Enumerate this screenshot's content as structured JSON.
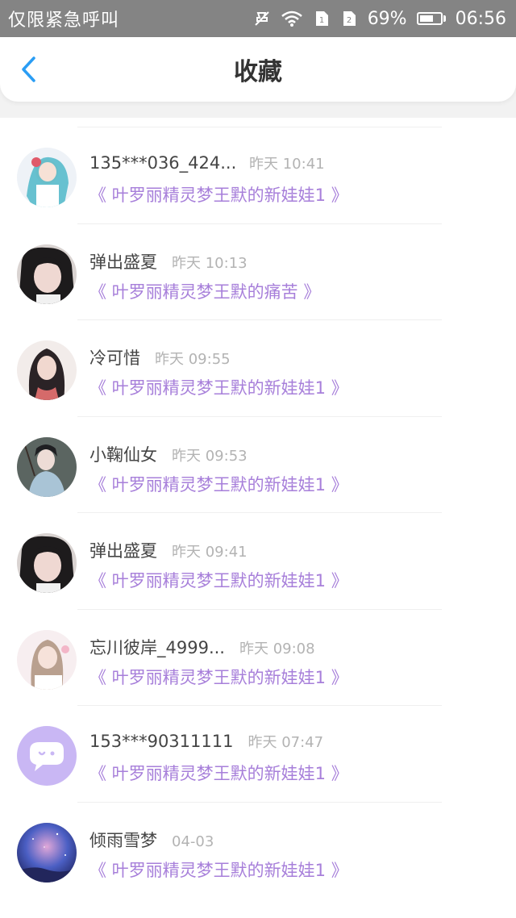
{
  "status_bar": {
    "carrier": "仅限紧急呼叫",
    "battery_text": "69%",
    "battery_level": 0.69,
    "time": "06:56",
    "icons": [
      "mute-icon",
      "wifi-icon",
      "sim1-icon",
      "sim2-icon",
      "battery-icon"
    ]
  },
  "header": {
    "title": "收藏",
    "back_icon": "chevron-left-icon",
    "accent_color": "#2a9df4"
  },
  "colors": {
    "book_link": "#a77fda",
    "name": "#454545",
    "time": "#b3b3b3"
  },
  "items": [
    {
      "name": "135***036_424...",
      "time": "昨天 10:41",
      "book": "《 叶罗丽精灵梦王默的新娃娃1 》",
      "avatar": "anime-girl-teal-hair"
    },
    {
      "name": "弹出盛夏",
      "time": "昨天 10:13",
      "book": "《 叶罗丽精灵梦王默的痛苦 》",
      "avatar": "girl-photo"
    },
    {
      "name": "冷可惜",
      "time": "昨天 09:55",
      "book": "《 叶罗丽精灵梦王默的新娃娃1 》",
      "avatar": "painted-girl-long-hair"
    },
    {
      "name": "小鞠仙女",
      "time": "昨天 09:53",
      "book": "《 叶罗丽精灵梦王默的新娃娃1 》",
      "avatar": "girl-photo-hanfu"
    },
    {
      "name": "弹出盛夏",
      "time": "昨天 09:41",
      "book": "《 叶罗丽精灵梦王默的新娃娃1 》",
      "avatar": "girl-photo"
    },
    {
      "name": "忘川彼岸_4999...",
      "time": "昨天 09:08",
      "book": "《 叶罗丽精灵梦王默的新娃娃1 》",
      "avatar": "anime-girl-pink"
    },
    {
      "name": "153***90311111",
      "time": "昨天 07:47",
      "book": "《 叶罗丽精灵梦王默的新娃娃1 》",
      "avatar": "default-chat-bubble"
    },
    {
      "name": "倾雨雪梦",
      "time": "04-03",
      "book": "《 叶罗丽精灵梦王默的新娃娃1 》",
      "avatar": "galaxy-sky"
    }
  ]
}
